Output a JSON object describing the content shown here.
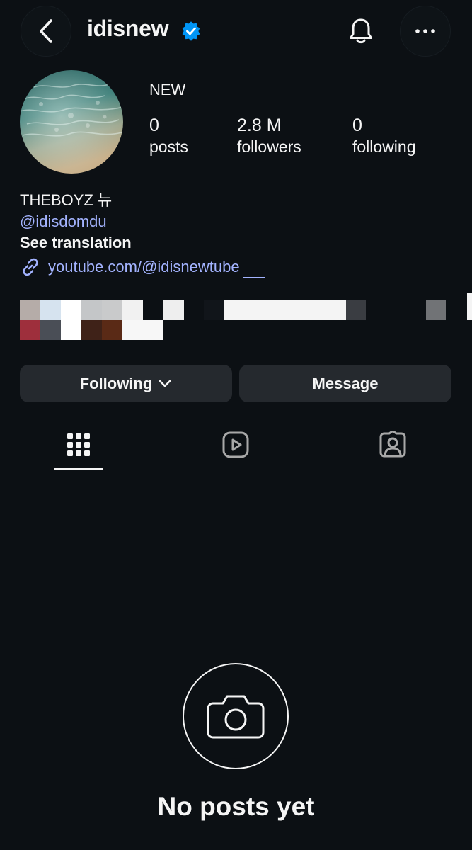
{
  "header": {
    "username": "idisnew",
    "verified": true,
    "back_icon": "chevron-left-icon",
    "notifications_icon": "bell-icon",
    "more_icon": "more-horizontal-icon"
  },
  "profile": {
    "display_name": "NEW",
    "stats": [
      {
        "value": "0",
        "label": "posts"
      },
      {
        "value": "2.8 M",
        "label": "followers"
      },
      {
        "value": "0",
        "label": "following"
      }
    ]
  },
  "bio": {
    "text": "THEBOYZ 뉴",
    "mention": "@idisdomdu",
    "translate": "See translation",
    "link_icon": "link-icon",
    "link": "youtube.com/@idisnewtube"
  },
  "actions": {
    "following_label": "Following",
    "message_label": "Message"
  },
  "tabs": [
    {
      "name": "grid",
      "icon": "grid-icon",
      "active": true
    },
    {
      "name": "reels",
      "icon": "reels-icon",
      "active": false
    },
    {
      "name": "tagged",
      "icon": "tagged-icon",
      "active": false
    }
  ],
  "empty_state": {
    "icon": "camera-icon",
    "title": "No posts yet"
  },
  "colors": {
    "background": "#0c1014",
    "button": "#25292e",
    "link": "#a3b3ff",
    "verified": "#0095f6"
  }
}
